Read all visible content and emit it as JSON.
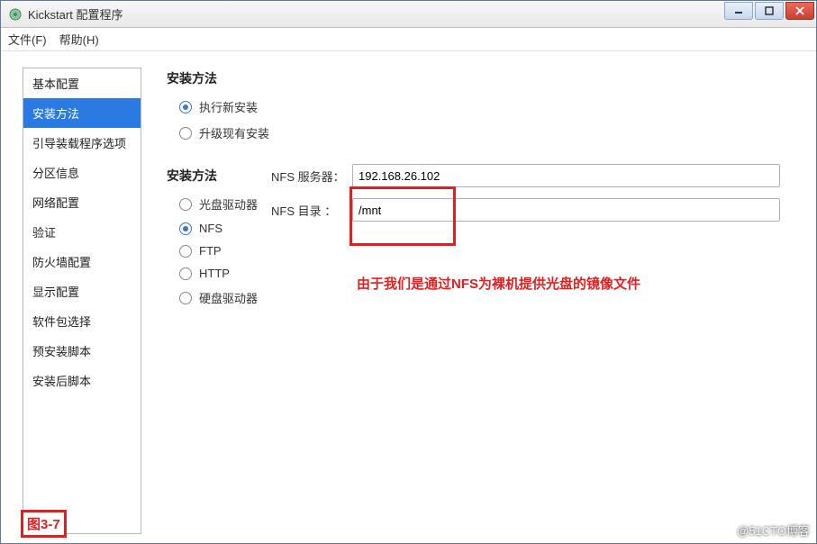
{
  "window": {
    "title": "Kickstart 配置程序"
  },
  "menubar": {
    "file": "文件(F)",
    "help": "帮助(H)"
  },
  "sidebar": {
    "items": [
      "基本配置",
      "安装方法",
      "引导装载程序选项",
      "分区信息",
      "网络配置",
      "验证",
      "防火墙配置",
      "显示配置",
      "软件包选择",
      "预安装脚本",
      "安装后脚本"
    ],
    "selected_index": 1
  },
  "main": {
    "install_type_title": "安装方法",
    "install_type_options": {
      "fresh": "执行新安装",
      "upgrade": "升级现有安装"
    },
    "install_method_title": "安装方法",
    "install_method_options": {
      "cdrom": "光盘驱动器",
      "nfs": "NFS",
      "ftp": "FTP",
      "http": "HTTP",
      "hdd": "硬盘驱动器"
    },
    "nfs_server_label": "NFS 服务器：",
    "nfs_server_value": "192.168.26.102",
    "nfs_dir_label": "NFS 目录 ：",
    "nfs_dir_value": "/mnt"
  },
  "annotation": {
    "text": "由于我们是通过NFS为裸机提供光盘的镜像文件",
    "figure_label": "图3-7"
  },
  "watermark": "@51CTO博客"
}
